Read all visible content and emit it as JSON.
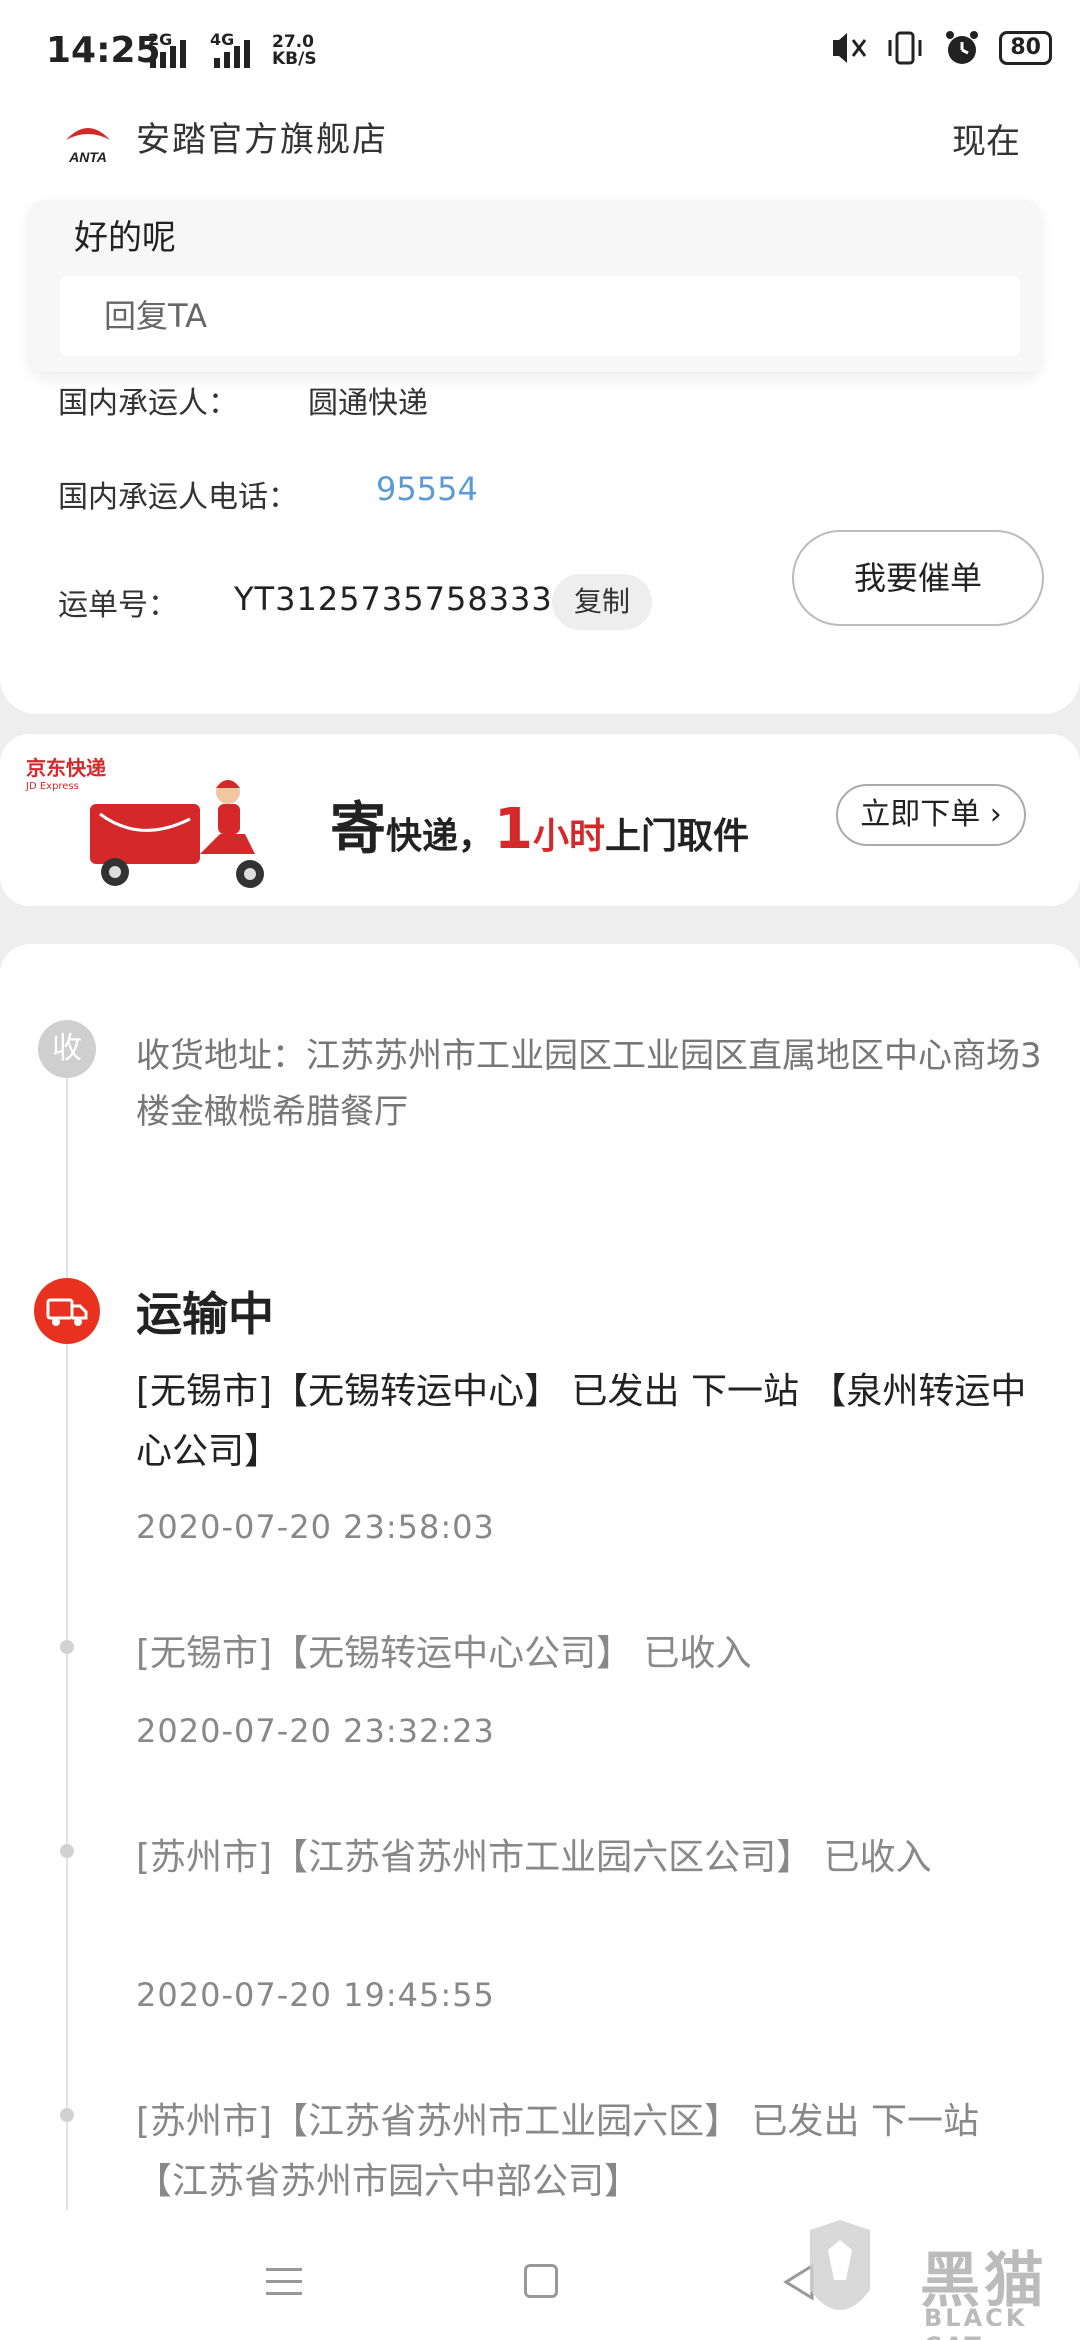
{
  "status_bar": {
    "time": "14:25",
    "sim1": "2G",
    "sim2": "4G",
    "net_speed": "27.0",
    "net_unit": "KB/S",
    "battery": "80"
  },
  "header": {
    "store_logo": "ANTA",
    "store_name": "安踏官方旗舰店",
    "time": "现在"
  },
  "reply": {
    "message": "好的呢",
    "input_placeholder": "回复TA"
  },
  "shipping": {
    "carrier_label": "国内承运人：",
    "carrier_value": "圆通快递",
    "phone_label": "国内承运人电话：",
    "phone_value": "95554",
    "waybill_label": "运单号：",
    "waybill_value": "YT3125735758333",
    "copy_label": "复制",
    "urge_label": "我要催单"
  },
  "banner": {
    "brand": "京东快递",
    "brand_en": "JD Express",
    "slogan_1": "寄",
    "slogan_2": "快递，",
    "slogan_3": "1",
    "slogan_4": "小时",
    "slogan_5": "上门取件",
    "order_label": "立即下单 ›"
  },
  "address": {
    "badge": "收",
    "text": "收货地址：江苏苏州市工业园区工业园区直属地区中心商场3楼金橄榄希腊餐厅"
  },
  "tracking": {
    "status": "运输中",
    "events": [
      {
        "text": "[无锡市]【无锡转运中心】 已发出 下一站 【泉州转运中心公司】",
        "time": "2020-07-20 23:58:03"
      },
      {
        "text": "[无锡市]【无锡转运中心公司】 已收入",
        "time": "2020-07-20 23:32:23"
      },
      {
        "text": "[苏州市]【江苏省苏州市工业园六区公司】 已收入",
        "time": "2020-07-20 19:45:55"
      },
      {
        "text": "[苏州市]【江苏省苏州市工业园六区】 已发出 下一站 【江苏省苏州市园六中部公司】",
        "time": ""
      }
    ]
  },
  "watermark": {
    "title": "黑猫",
    "subtitle": "BLACK CAT"
  },
  "colors": {
    "accent_red": "#e8321f",
    "link_blue": "#5b9bd5"
  }
}
